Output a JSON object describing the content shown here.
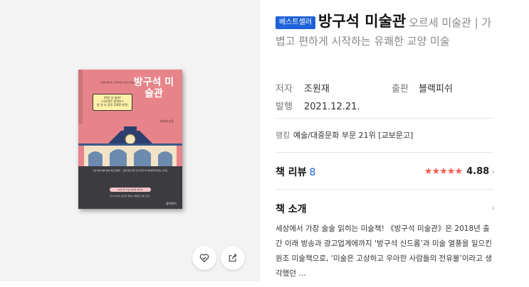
{
  "cover": {
    "book_title": "방구석 미술관",
    "tag_line": "그림을 알아야 그리워지는 미술의 모든 것",
    "sticker": "40만 부 돌파!\n+LUCKY 컬렉션+\n한 권 더 증정 (28명 한정)",
    "author": "조원재 지음",
    "band_text": "2년 연속 예술 분야 베스트셀러 · 교육그램 추천 도서 방구석 미술관을 전하는 시리즈",
    "pill": "40만 부 기념 럭셔리 에디션",
    "band_text2": "당신의 미의 감각을 깨우는 특별한 미술 교양",
    "publisher": "블랙피쉬"
  },
  "actions": {
    "wishlist_icon": "heart-check-icon",
    "share_icon": "share-icon"
  },
  "product": {
    "badge": "베스트셀러",
    "title": "방구석 미술관",
    "subtitle": "오르세 미술관 | 가볍고 편하게 시작하는 유쾌한 교양 미술"
  },
  "meta": {
    "author_label": "저자",
    "author": "조원재",
    "publisher_label": "출판",
    "publisher": "블랙피쉬",
    "date_label": "발행",
    "date": "2021.12.21."
  },
  "ranking": {
    "label": "랭킹",
    "value": "예술/대중문화 부문 21위 [교보문고]"
  },
  "review": {
    "label": "책 리뷰",
    "count": "8",
    "stars": "★★★★★",
    "score": "4.88",
    "rating_fraction": 0.976
  },
  "intro": {
    "label": "책 소개",
    "text": "세상에서 가장 술술 읽히는 미술책! 《방구석 미술관》은 2018년 출간 이래 방송과 광고업계에까지 ‘방구석 신드롬’과 미술 열풍을 일으킨 원조 미술책으로, ‘미술은 고상하고 우아한 사람들의 전유물’이라고 생각했던 …"
  },
  "colors": {
    "badge_bg": "#1e62d8",
    "count": "#1e62d8",
    "stars": "#ff5a52",
    "cover_pink": "#e7848a",
    "cover_band": "#3c3c40"
  }
}
